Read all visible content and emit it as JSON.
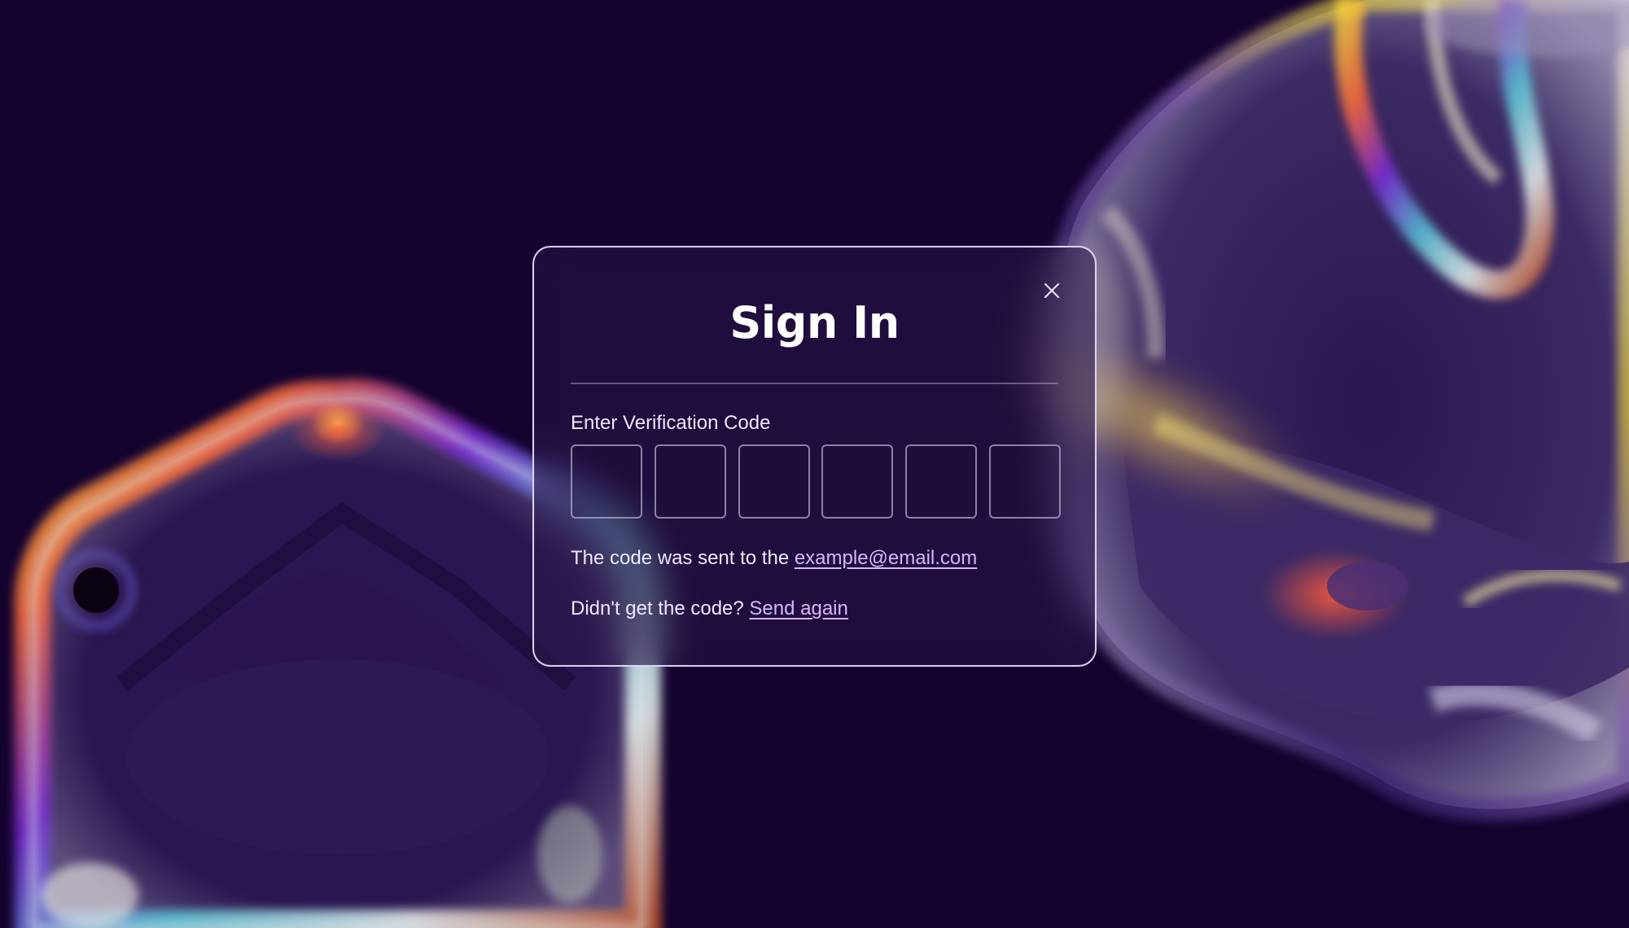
{
  "modal": {
    "title": "Sign In",
    "close_icon": "close-icon",
    "code_label": "Enter Verification Code",
    "code_digits": [
      "",
      "",
      "",
      "",
      "",
      ""
    ],
    "sent_prefix": "The code was sent to the ",
    "email": "example@email.com",
    "resend_prefix": "Didn't get the code? ",
    "resend_label": "Send again"
  },
  "colors": {
    "background": "#14032f",
    "link": "#d8b6ff",
    "text": "#efe9fb",
    "border": "#ebe1ff"
  }
}
